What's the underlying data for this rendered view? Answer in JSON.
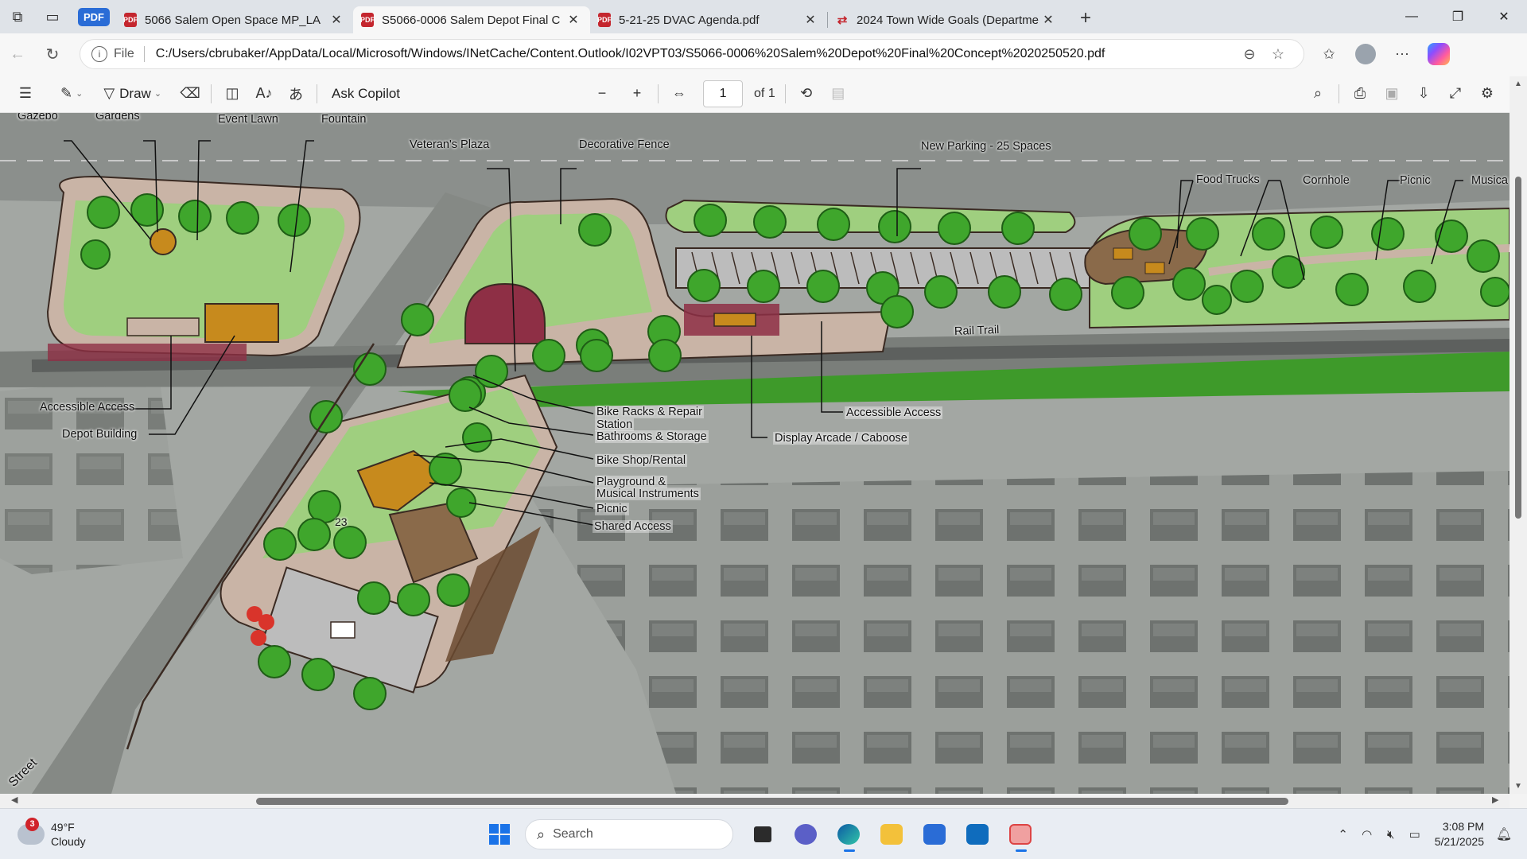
{
  "browser": {
    "pdf_badge": "PDF",
    "tabs": [
      {
        "label": "5066 Salem Open Space MP_LA",
        "icon": "pdf-icon"
      },
      {
        "label": "S5066-0006 Salem Depot Final C",
        "icon": "pdf-icon"
      },
      {
        "label": "5-21-25 DVAC Agenda.pdf",
        "icon": "pdf-icon"
      },
      {
        "label": "2024 Town Wide Goals (Departme",
        "icon": "link-icon"
      }
    ],
    "address": {
      "scheme": "File",
      "url": "C:/Users/cbrubaker/AppData/Local/Microsoft/Windows/INetCache/Content.Outlook/I02VPT03/S5066-0006%20Salem%20Depot%20Final%20Concept%2020250520.pdf"
    }
  },
  "pdf_toolbar": {
    "draw_label": "Draw",
    "ask_copilot_label": "Ask Copilot",
    "page_number": "1",
    "page_of": "of 1"
  },
  "plan": {
    "labels": {
      "gazebo": "Gazebo",
      "gardens": "Gardens",
      "event_lawn": "Event Lawn",
      "fountain": "Fountain",
      "veterans_plaza": "Veteran's Plaza",
      "decorative_fence": "Decorative Fence",
      "new_parking": "New Parking - 25 Spaces",
      "food_trucks": "Food Trucks",
      "cornhole": "Cornhole",
      "picnic_top": "Picnic",
      "music": "Musica",
      "rail_trail": "Rail Trail",
      "accessible_access_left": "Accessible Access",
      "depot_building": "Depot Building",
      "bike_racks_1": "Bike Racks & Repair",
      "bike_racks_2": "Station",
      "bathrooms": "Bathrooms & Storage",
      "bike_shop": "Bike Shop/Rental",
      "playground_1": "Playground &",
      "playground_2": "Musical Instruments",
      "picnic_bottom": "Picnic",
      "shared_access": "Shared Access",
      "accessible_access_right": "Accessible Access",
      "display_arcade": "Display Arcade / Caboose",
      "parking_count": "23",
      "street": "Street"
    }
  },
  "taskbar": {
    "weather": {
      "badge": "3",
      "temp": "49°F",
      "condition": "Cloudy"
    },
    "search_placeholder": "Search",
    "clock": {
      "time": "3:08 PM",
      "date": "5/21/2025"
    }
  },
  "colors": {
    "lawn": "#9fcf7f",
    "tree": "#3fa62c",
    "plaza": "#8e2f45",
    "path": "#c9b4a6",
    "building": "#c78a1d",
    "accent": "#1a73e8"
  }
}
